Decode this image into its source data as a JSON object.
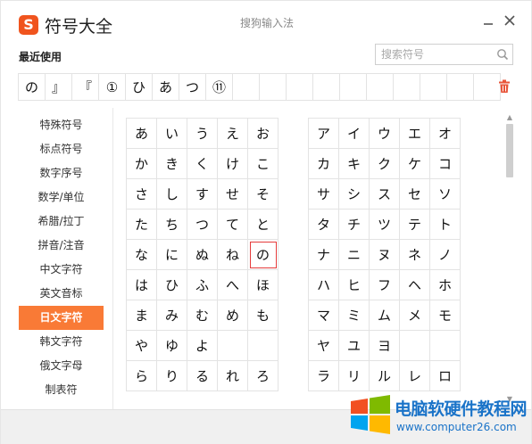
{
  "titlebar": {
    "logo_letter": "S",
    "app_title": "符号大全",
    "subtitle": "搜狗输入法"
  },
  "recent": {
    "label": "最近使用",
    "items": [
      "の",
      "』",
      "『",
      "①",
      "ひ",
      "あ",
      "つ",
      "⑪",
      "",
      "",
      "",
      "",
      "",
      "",
      "",
      "",
      "",
      ""
    ]
  },
  "search": {
    "placeholder": "搜索符号"
  },
  "sidebar": {
    "items": [
      "特殊符号",
      "标点符号",
      "数字序号",
      "数学/单位",
      "希腊/拉丁",
      "拼音/注音",
      "中文字符",
      "英文音标",
      "日文字符",
      "韩文字符",
      "俄文字母",
      "制表符"
    ],
    "active_index": 8
  },
  "hiragana": {
    "rows": [
      [
        "あ",
        "い",
        "う",
        "え",
        "お"
      ],
      [
        "か",
        "き",
        "く",
        "け",
        "こ"
      ],
      [
        "さ",
        "し",
        "す",
        "せ",
        "そ"
      ],
      [
        "た",
        "ち",
        "つ",
        "て",
        "と"
      ],
      [
        "な",
        "に",
        "ぬ",
        "ね",
        "の"
      ],
      [
        "は",
        "ひ",
        "ふ",
        "へ",
        "ほ"
      ],
      [
        "ま",
        "み",
        "む",
        "め",
        "も"
      ],
      [
        "や",
        "ゆ",
        "よ",
        "",
        ""
      ],
      [
        "ら",
        "り",
        "る",
        "れ",
        "ろ"
      ]
    ],
    "selected": "の"
  },
  "katakana": {
    "rows": [
      [
        "ア",
        "イ",
        "ウ",
        "エ",
        "オ"
      ],
      [
        "カ",
        "キ",
        "ク",
        "ケ",
        "コ"
      ],
      [
        "サ",
        "シ",
        "ス",
        "セ",
        "ソ"
      ],
      [
        "タ",
        "チ",
        "ツ",
        "テ",
        "ト"
      ],
      [
        "ナ",
        "ニ",
        "ヌ",
        "ネ",
        "ノ"
      ],
      [
        "ハ",
        "ヒ",
        "フ",
        "ヘ",
        "ホ"
      ],
      [
        "マ",
        "ミ",
        "ム",
        "メ",
        "モ"
      ],
      [
        "ヤ",
        "ユ",
        "ヨ",
        "",
        ""
      ],
      [
        "ラ",
        "リ",
        "ル",
        "レ",
        "ロ"
      ]
    ]
  },
  "watermark": {
    "text": "电脑软硬件教程网",
    "url": "www.computer26.com"
  },
  "colors": {
    "accent": "#f97a36",
    "logo": "#f0541e",
    "selected_border": "#e53b3b",
    "trash": "#e8553a",
    "watermark": "#1a73c8"
  },
  "icons": {
    "minimize": "minimize-icon",
    "close": "close-icon",
    "search": "search-icon",
    "trash": "trash-icon"
  }
}
